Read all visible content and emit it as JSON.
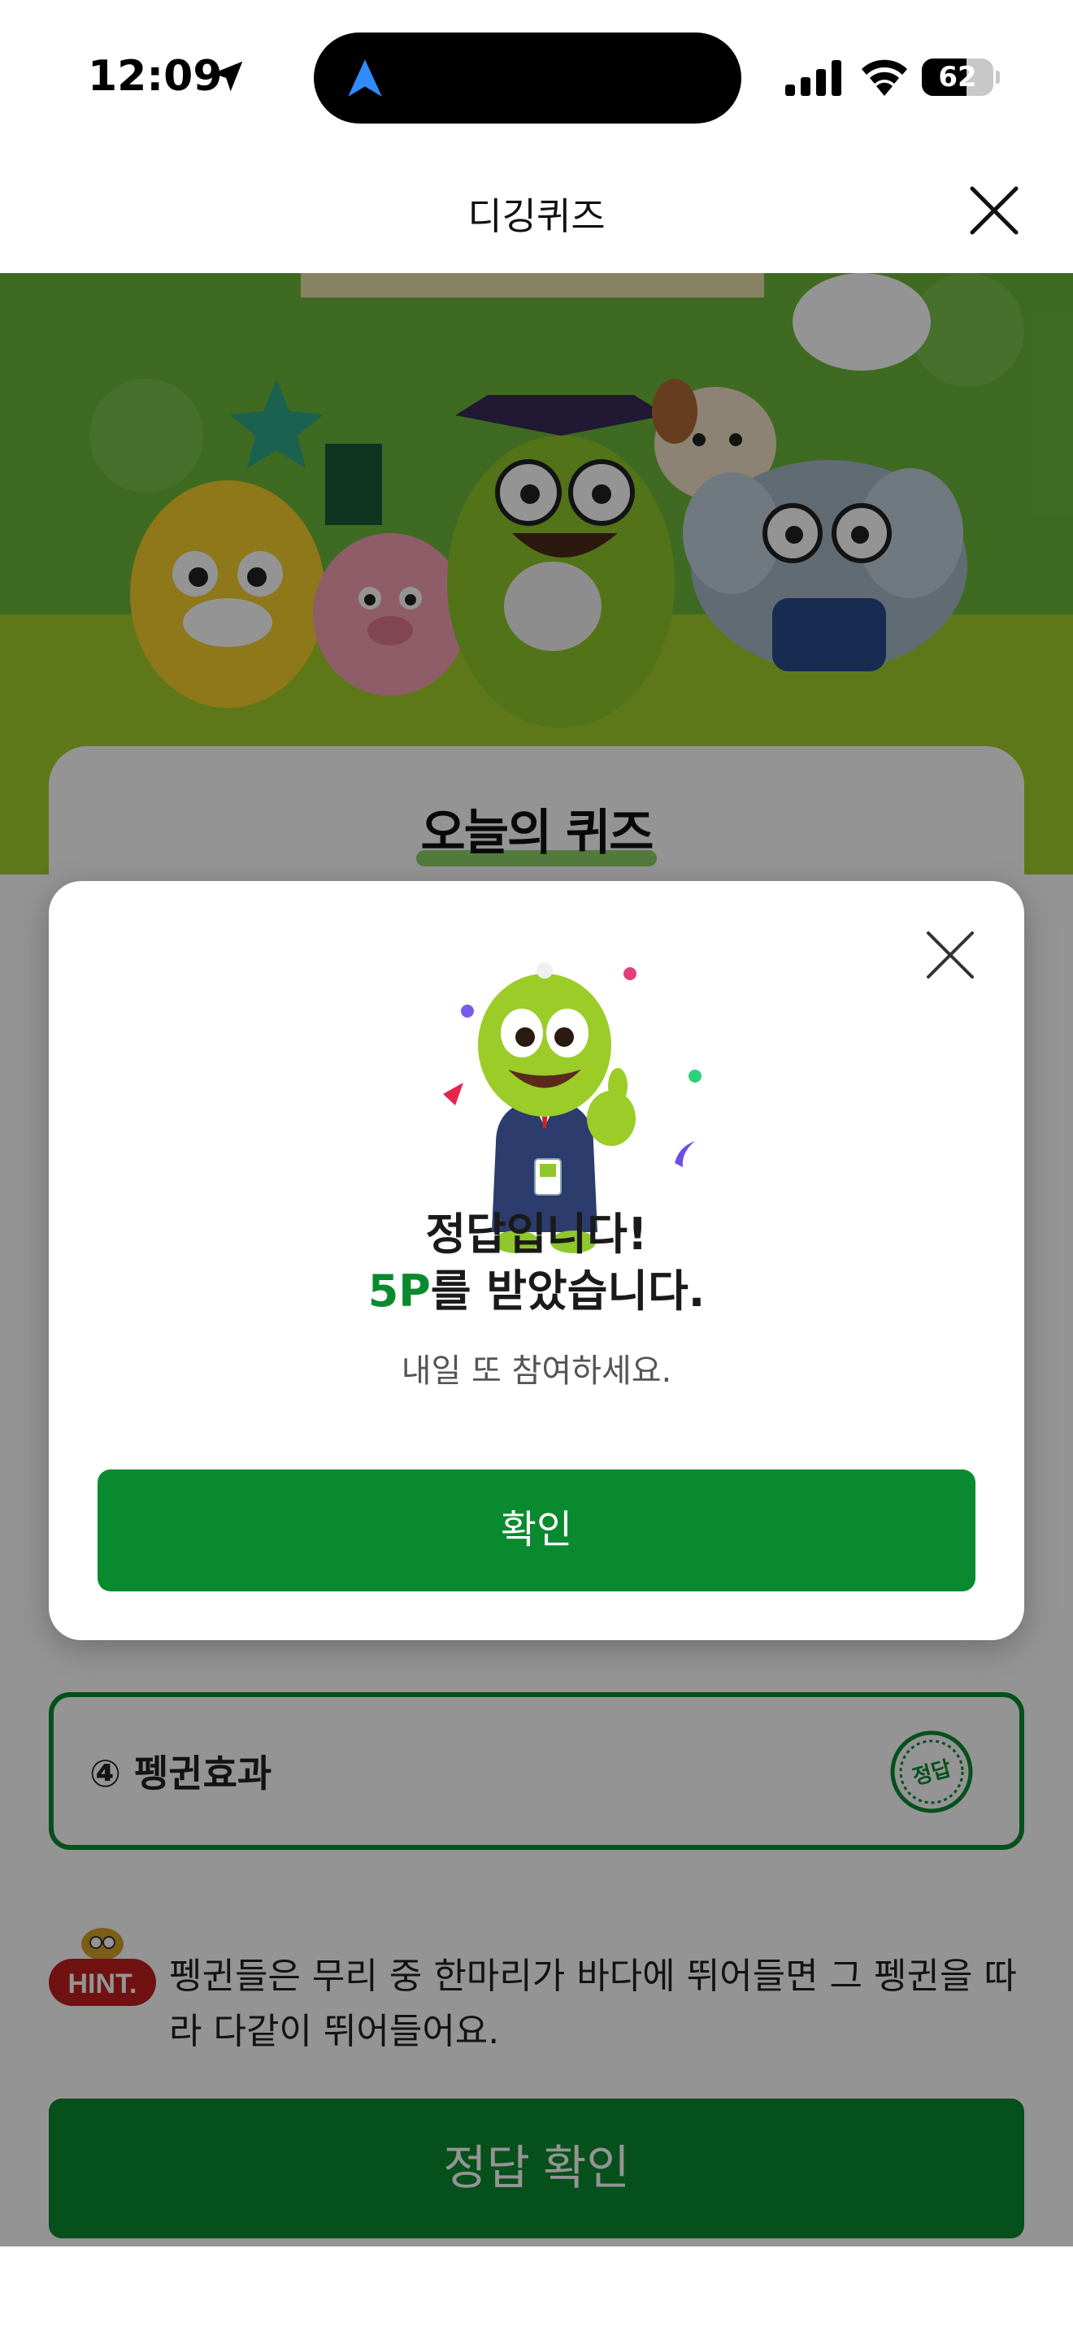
{
  "status_bar": {
    "time": "12:09",
    "battery": "62",
    "battery_level": 0.62,
    "icons": [
      "location-arrow-icon",
      "navigation-icon",
      "cellular-signal-icon",
      "wifi-icon",
      "battery-icon"
    ]
  },
  "header": {
    "title": "디깅퀴즈",
    "close_icon": "close-icon"
  },
  "quiz": {
    "heading": "오늘의 퀴즈",
    "option_4": "④ 펭귄효과",
    "answer_stamp": "정답",
    "hint_label": "HINT.",
    "hint_text": "펭귄들은 무리 중 한마리가 바다에 뛰어들면 그 펭귄을 따라 다같이 뛰어들어요.",
    "check_button": "정답 확인",
    "colors": {
      "brand_green": "#0a8a2f",
      "banner_green": "#6cb83a"
    }
  },
  "modal": {
    "title": "정답입니다!",
    "reward_points": "5P",
    "reward_suffix": "를 받았습니다.",
    "subtitle": "내일 또 참여하세요.",
    "confirm_button": "확인",
    "close_icon": "close-icon"
  }
}
